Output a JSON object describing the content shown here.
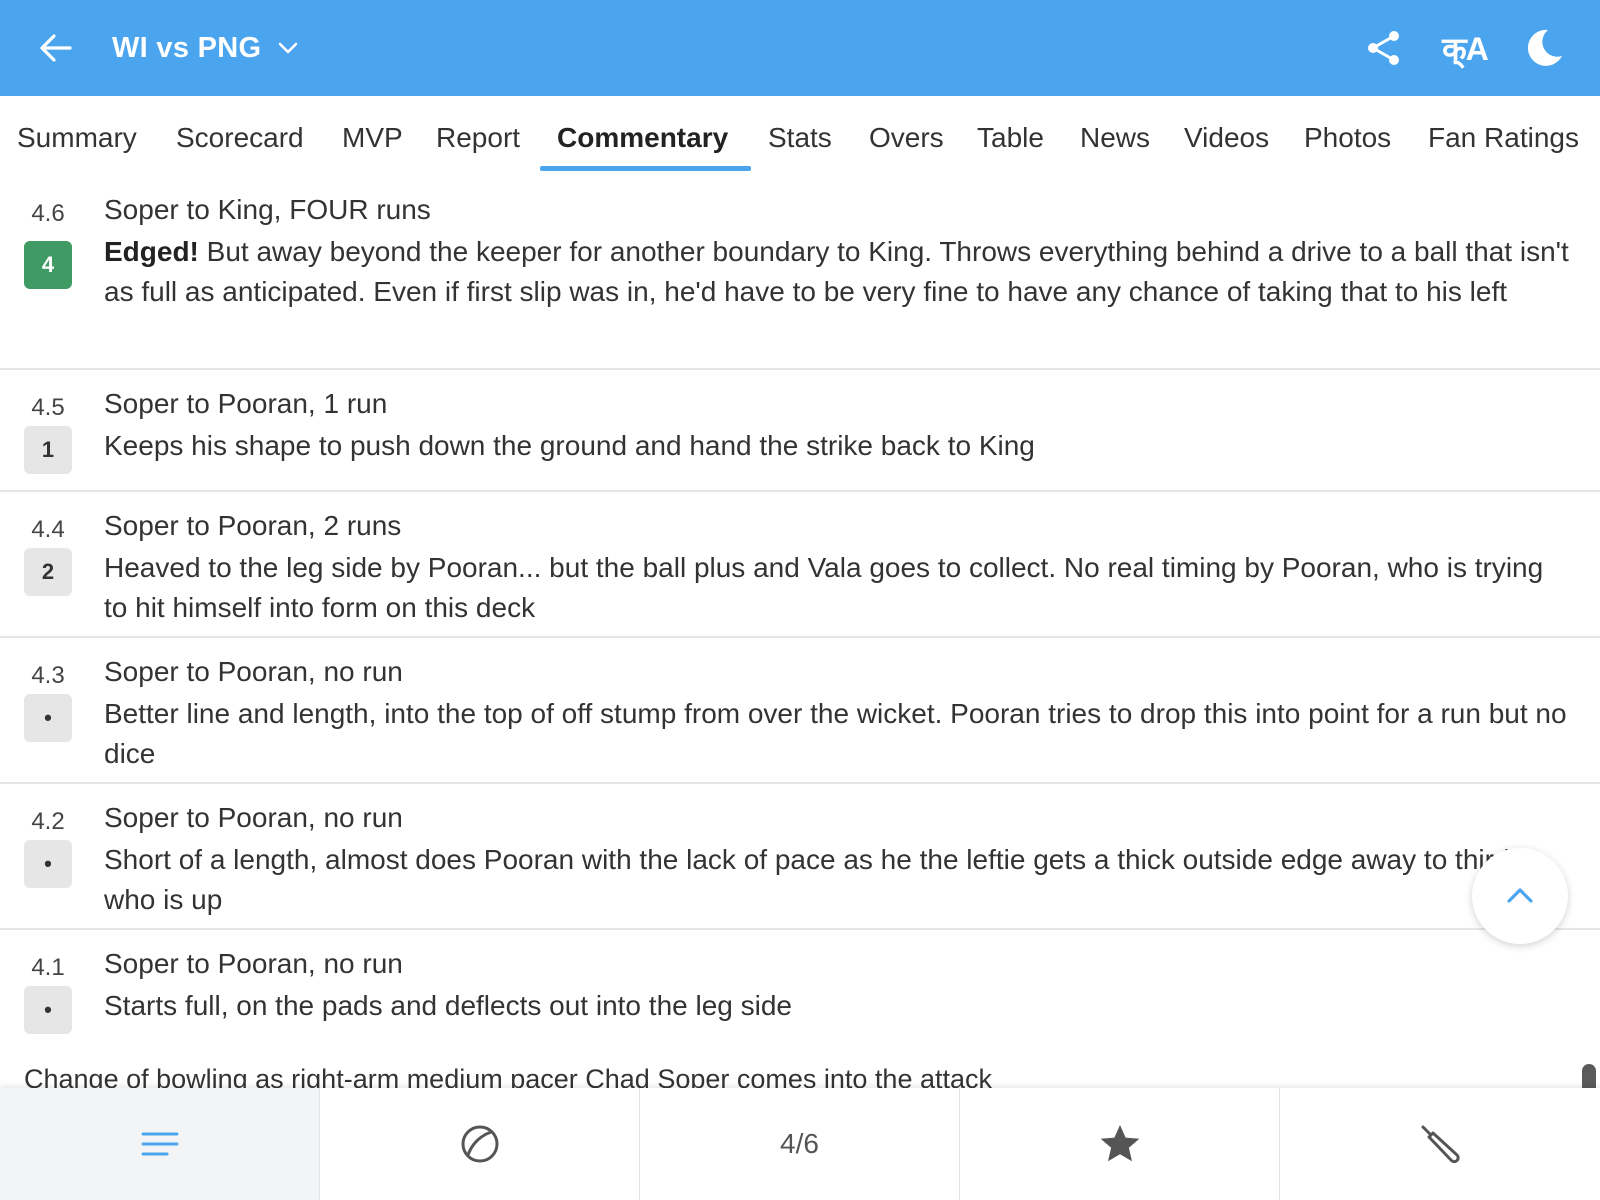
{
  "header": {
    "title": "WI vs PNG",
    "lang_label": "क्A",
    "icons": [
      "back-arrow-icon",
      "chevron-down-icon",
      "share-icon",
      "language-icon",
      "moon-icon"
    ]
  },
  "tabs": [
    {
      "label": "Summary"
    },
    {
      "label": "Scorecard"
    },
    {
      "label": "MVP"
    },
    {
      "label": "Report"
    },
    {
      "label": "Commentary"
    },
    {
      "label": "Stats"
    },
    {
      "label": "Overs"
    },
    {
      "label": "Table"
    },
    {
      "label": "News"
    },
    {
      "label": "Videos"
    },
    {
      "label": "Photos"
    },
    {
      "label": "Fan Ratings"
    }
  ],
  "active_tab": "Commentary",
  "commentary": [
    {
      "over": "4.6",
      "badge": "4",
      "head": "Soper to King, FOUR runs",
      "bold": "Edged!",
      "text": " But away beyond the keeper for another boundary to King. Throws everything behind a drive to a ball that isn't as full as anticipated. Even if first slip was in, he'd have to be very fine to have any chance of taking that to his left"
    },
    {
      "over": "4.5",
      "badge": "1",
      "head": "Soper to Pooran, 1 run",
      "bold": "",
      "text": "Keeps his shape to push down the ground and hand the strike back to King"
    },
    {
      "over": "4.4",
      "badge": "2",
      "head": "Soper to Pooran, 2 runs",
      "bold": "",
      "text": "Heaved to the leg side by Pooran... but the ball plus and Vala goes to collect. No real timing by Pooran, who is trying to hit himself into form on this deck"
    },
    {
      "over": "4.3",
      "badge": "•",
      "head": "Soper to Pooran, no run",
      "bold": "",
      "text": "Better line and length, into the top of off stump from over the wicket. Pooran tries to drop this into point for a run but no dice"
    },
    {
      "over": "4.2",
      "badge": "•",
      "head": "Soper to Pooran, no run",
      "bold": "",
      "text": "Short of a length, almost does Pooran with the lack of pace as he the leftie gets a thick outside edge away to third, who is up"
    },
    {
      "over": "4.1",
      "badge": "•",
      "head": "Soper to Pooran, no run",
      "bold": "",
      "text": "Starts full, on the pads and deflects out into the leg side"
    }
  ],
  "change_bowler": "Change of bowling as right-arm medium pacer Chad Soper comes into the attack",
  "bottom_bar": {
    "items": [
      {
        "icon": "list-icon"
      },
      {
        "icon": "ball-icon"
      },
      {
        "label": "4/6"
      },
      {
        "icon": "star-icon"
      },
      {
        "icon": "bat-icon"
      }
    ]
  },
  "colors": {
    "header": "#4aa5ee",
    "accent": "#4aa5ee",
    "four_badge": "#3f9a64"
  }
}
